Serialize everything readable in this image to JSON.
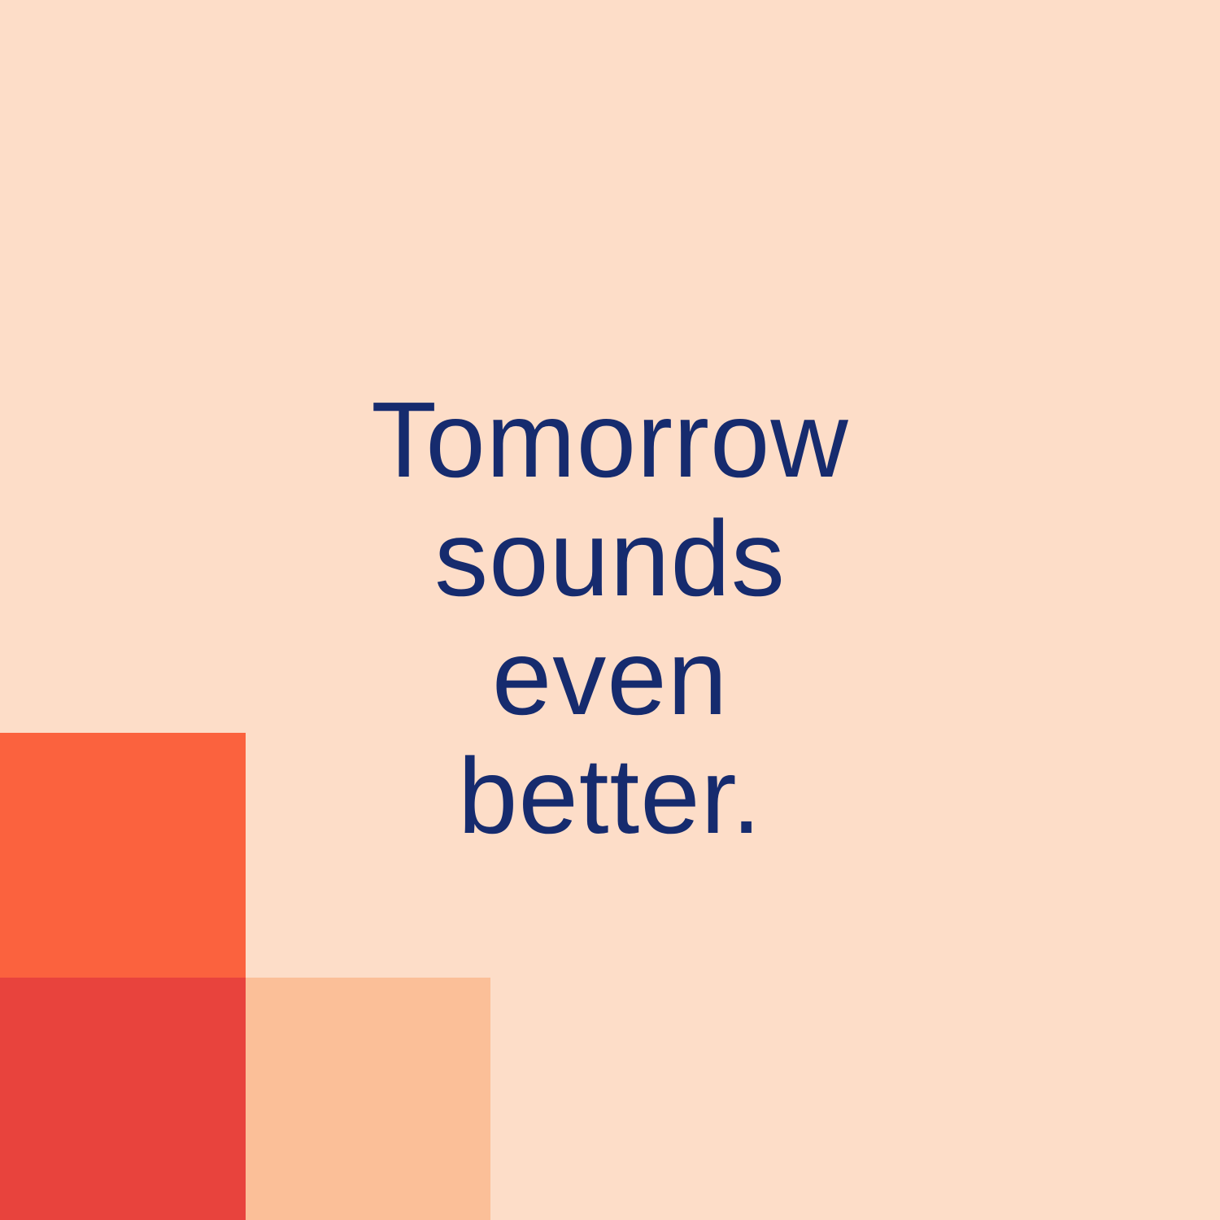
{
  "headline": {
    "lines": [
      "Tomorrow",
      "sounds",
      "even",
      "better."
    ]
  },
  "colors": {
    "background": "#FDDDC8",
    "text": "#162B6E",
    "block_orange": "#FB623E",
    "block_red": "#E8433D",
    "block_peach": "#FBBF98"
  }
}
